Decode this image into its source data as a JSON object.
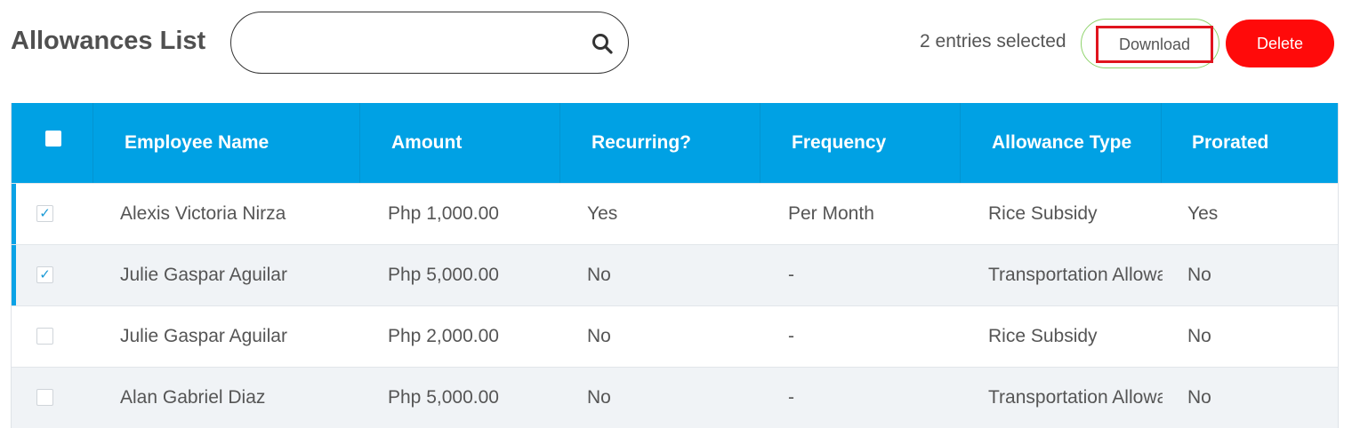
{
  "header": {
    "title": "Allowances List",
    "search_placeholder": "",
    "selected_text": "2 entries selected",
    "download_label": "Download",
    "delete_label": "Delete"
  },
  "table": {
    "columns": [
      "Employee Name",
      "Amount",
      "Recurring?",
      "Frequency",
      "Allowance Type",
      "Prorated"
    ],
    "rows": [
      {
        "checked": true,
        "name": "Alexis Victoria Nirza",
        "amount": "Php 1,000.00",
        "recurring": "Yes",
        "frequency": "Per Month",
        "type": "Rice Subsidy",
        "prorated": "Yes"
      },
      {
        "checked": true,
        "name": "Julie Gaspar Aguilar",
        "amount": "Php 5,000.00",
        "recurring": "No",
        "frequency": "-",
        "type": "Transportation Allowance",
        "prorated": "No"
      },
      {
        "checked": false,
        "name": "Julie Gaspar Aguilar",
        "amount": "Php 2,000.00",
        "recurring": "No",
        "frequency": "-",
        "type": "Rice Subsidy",
        "prorated": "No"
      },
      {
        "checked": false,
        "name": "Alan Gabriel Diaz",
        "amount": "Php 5,000.00",
        "recurring": "No",
        "frequency": "-",
        "type": "Transportation Allowance",
        "prorated": "No"
      }
    ]
  },
  "colors": {
    "header_bg": "#00a1e4",
    "delete_bg": "#ff0a0a",
    "highlight": "#e0141e",
    "check": "#1a9ad6"
  },
  "icons": {
    "search": "search-icon",
    "check": "check-icon"
  }
}
